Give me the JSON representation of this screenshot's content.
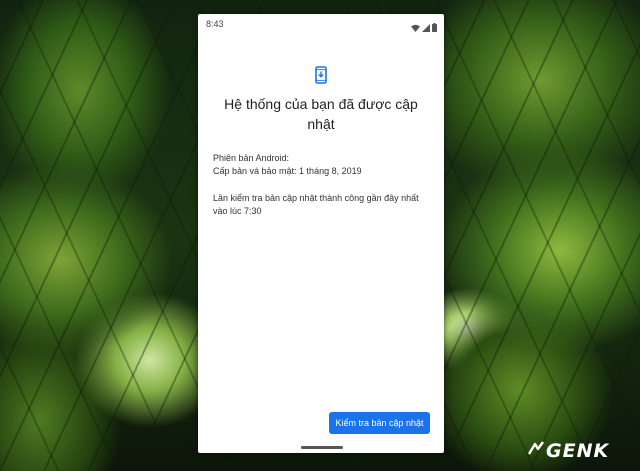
{
  "status_bar": {
    "time": "8:43"
  },
  "icons": {
    "app": "system-update-phone-icon",
    "wifi": "wifi-icon",
    "signal": "signal-icon",
    "battery": "battery-icon"
  },
  "colors": {
    "accent": "#1a73e8"
  },
  "update_screen": {
    "title": "Hệ thống của bạn đã được cập nhật",
    "android_version_label": "Phiên bản Android:",
    "security_patch": "Cấp bản vá bảo mật: 1 tháng 8, 2019",
    "last_check": "Lần kiểm tra bản cập nhật thành công gần đây nhất vào lúc 7:30",
    "check_button_label": "Kiểm tra bản cập nhật"
  },
  "watermark": {
    "text": "GENK"
  }
}
